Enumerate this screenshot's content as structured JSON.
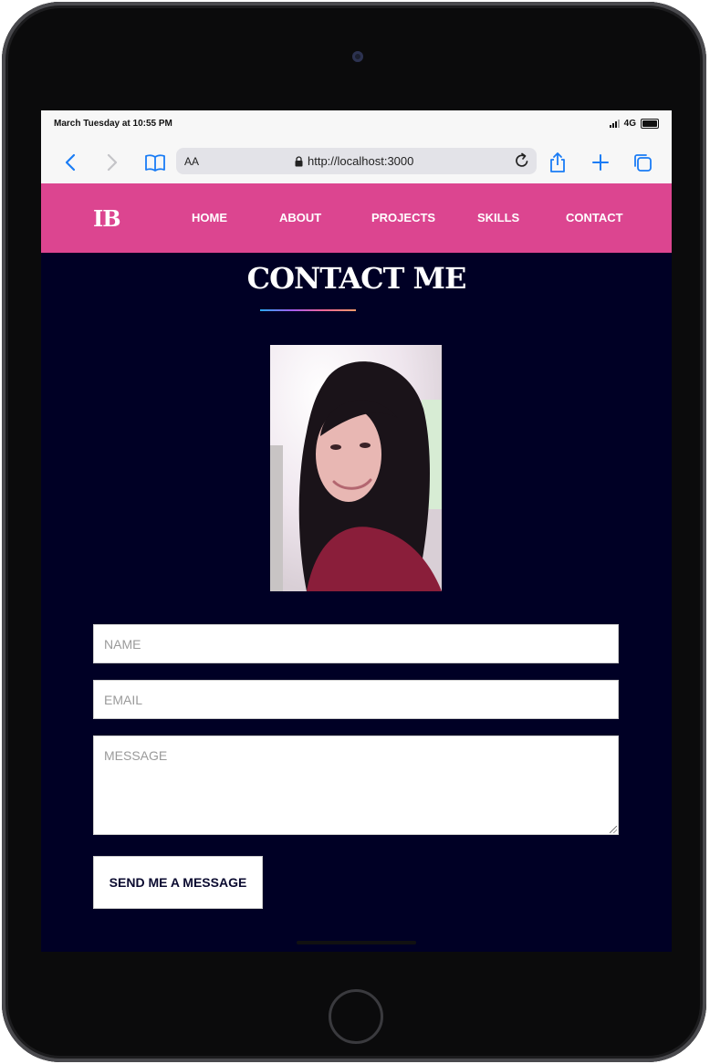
{
  "statusbar": {
    "time": "March Tuesday at 10:55 PM",
    "network": "4G"
  },
  "browser": {
    "text_size_label": "AA",
    "url": "http://localhost:3000"
  },
  "site": {
    "logo": "IB",
    "nav": [
      "HOME",
      "ABOUT",
      "PROJECTS",
      "SKILLS",
      "CONTACT"
    ],
    "heading": "CONTACT ME"
  },
  "form": {
    "name_placeholder": "NAME",
    "email_placeholder": "EMAIL",
    "message_placeholder": "MESSAGE",
    "submit_label": "SEND ME A MESSAGE"
  },
  "colors": {
    "nav_bg": "#dc4590",
    "page_bg": "#000025",
    "browser_accent": "#1a7cf5"
  },
  "icons": [
    "back-icon",
    "forward-icon",
    "bookmarks-icon",
    "lock-icon",
    "reload-icon",
    "share-icon",
    "new-tab-icon",
    "tabs-icon"
  ]
}
